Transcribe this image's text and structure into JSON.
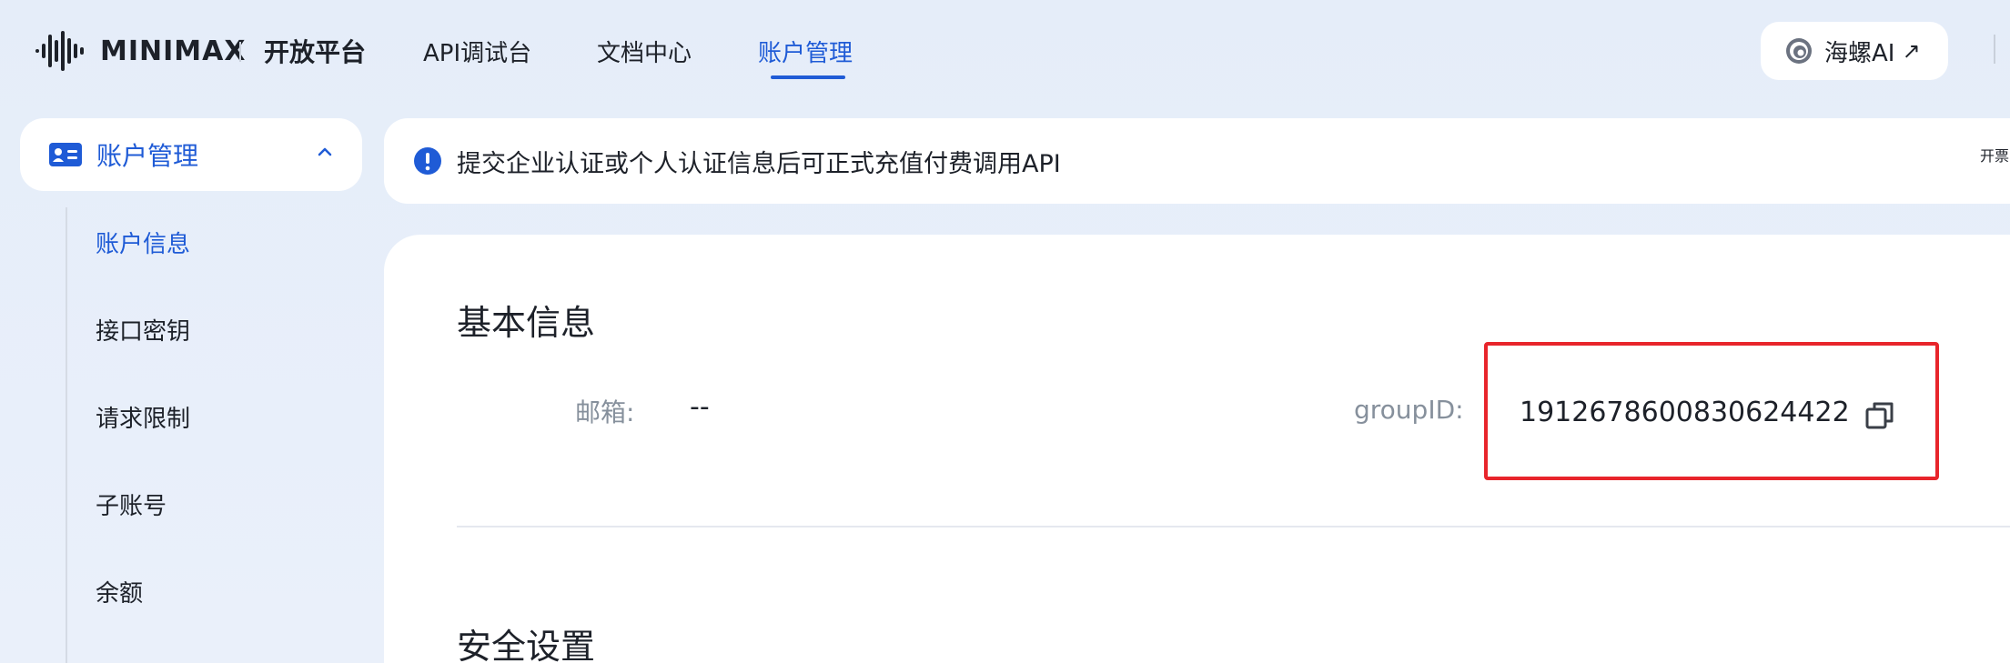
{
  "header": {
    "logo_text": "MINIMAX",
    "platform_title": "开放平台",
    "nav": [
      {
        "label": "API调试台"
      },
      {
        "label": "文档中心"
      },
      {
        "label": "账户管理",
        "active": true
      }
    ],
    "hailuo_label": "海螺AI",
    "hailuo_arrow": "↗"
  },
  "sidebar": {
    "group_label": "账户管理",
    "items": [
      {
        "label": "账户信息",
        "active": true
      },
      {
        "label": "接口密钥"
      },
      {
        "label": "请求限制"
      },
      {
        "label": "子账号"
      },
      {
        "label": "余额"
      }
    ]
  },
  "notice": {
    "text": "提交企业认证或个人认证信息后可正式充值付费调用API",
    "link": "开票"
  },
  "basic_info": {
    "title": "基本信息",
    "email_label": "邮箱:",
    "email_value": "--",
    "group_id_label": "groupID:",
    "group_id_value": "1912678600830624422"
  },
  "security": {
    "title": "安全设置"
  },
  "colors": {
    "accent": "#1f5bd6",
    "highlight_border": "#e8252b",
    "background": "#e7eef9"
  }
}
